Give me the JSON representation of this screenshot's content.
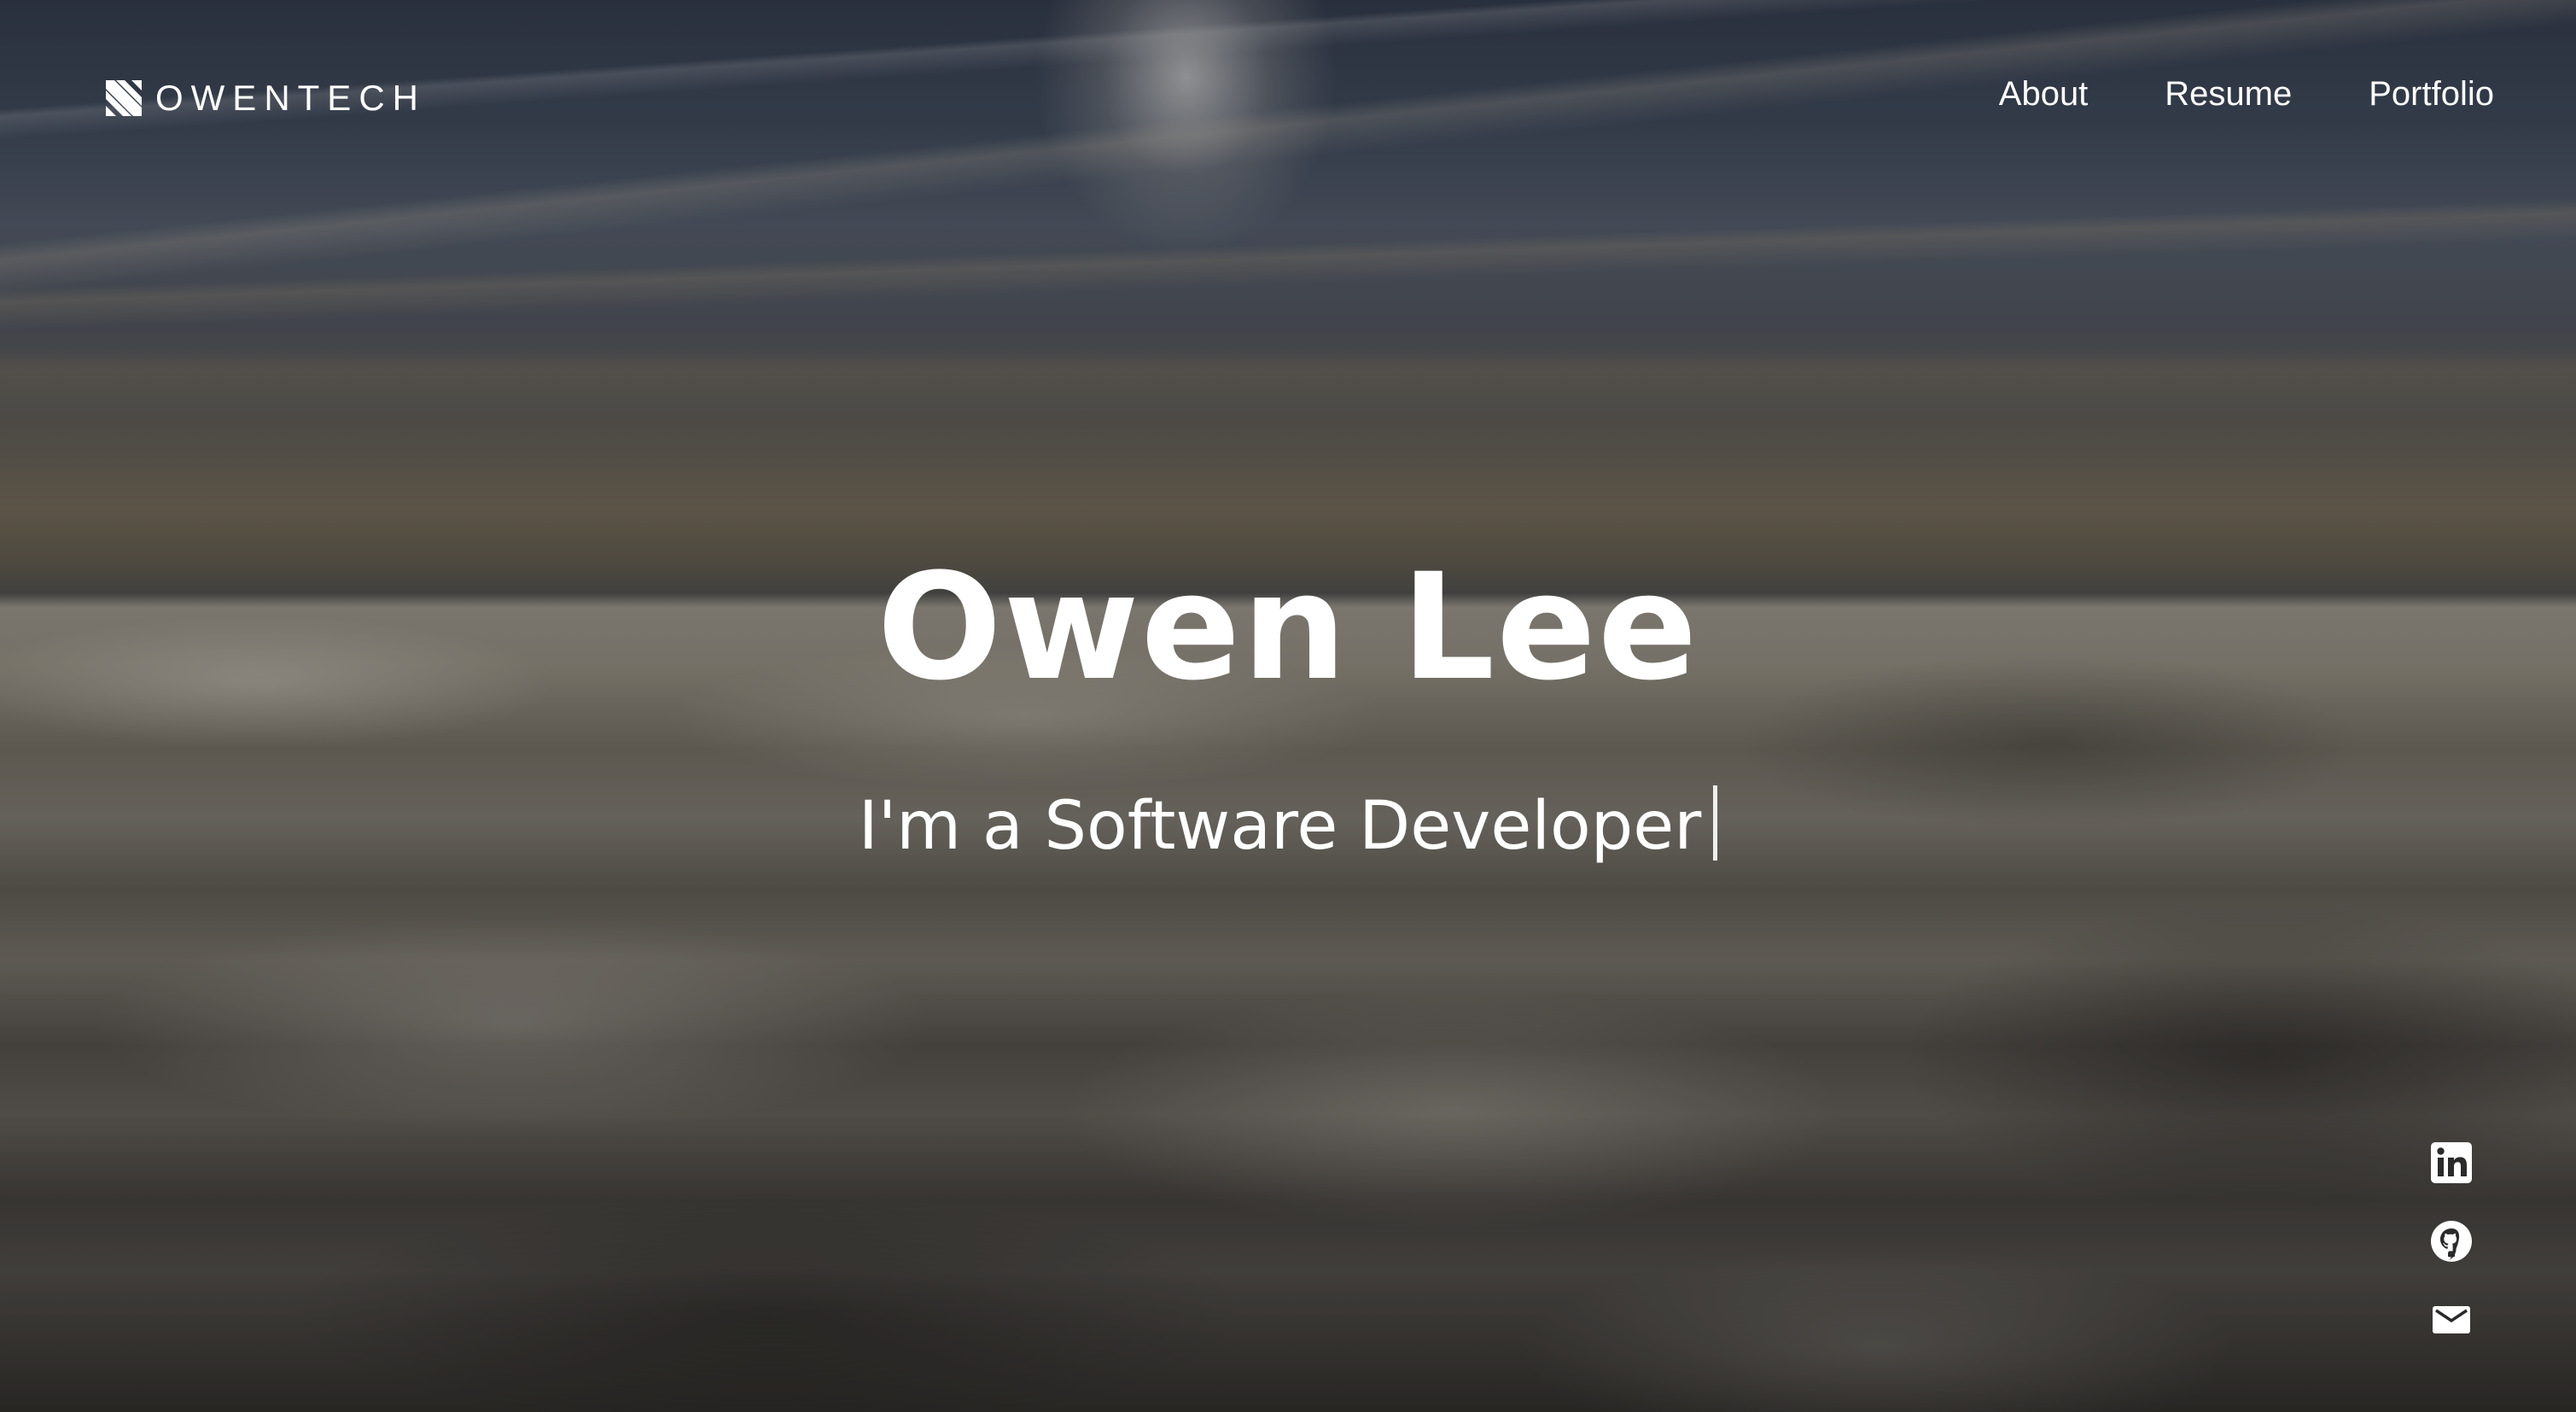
{
  "brand": {
    "name": "OWENTECH",
    "icon": "brand-logo-icon"
  },
  "nav": {
    "items": [
      {
        "label": "About"
      },
      {
        "label": "Resume"
      },
      {
        "label": "Portfolio"
      }
    ]
  },
  "hero": {
    "name": "Owen Lee",
    "tagline": "I'm a Software Developer"
  },
  "socials": [
    {
      "icon": "linkedin-icon"
    },
    {
      "icon": "github-icon"
    },
    {
      "icon": "mail-icon"
    }
  ],
  "colors": {
    "text": "#ffffff"
  }
}
